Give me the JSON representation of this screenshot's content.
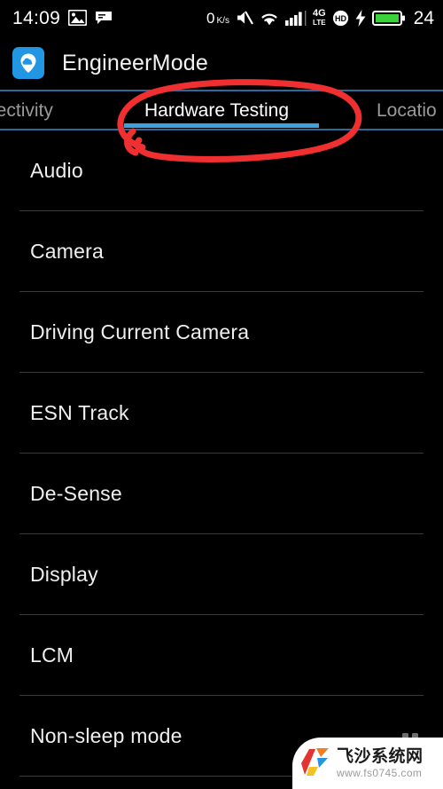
{
  "status_bar": {
    "clock": "14:09",
    "left_icons": [
      "image-icon",
      "message-icon"
    ],
    "net_speed_value": "0",
    "net_speed_unit_top": "K",
    "net_speed_unit_slash": "/",
    "net_speed_unit_bottom": "s",
    "right_icons": [
      "mute-icon",
      "wifi-icon",
      "signal-bars-icon",
      "4g-lte-icon",
      "hd-icon",
      "charging-bolt-icon",
      "battery-icon"
    ],
    "network_type_top": "4G",
    "network_type_bottom": "LTE",
    "hd_label": "HD",
    "battery_level": "24",
    "battery_color": "#3bd13b"
  },
  "app_bar": {
    "icon_name": "engineermode-app-icon",
    "icon_bg": "#2196e3",
    "title": "EngineerMode"
  },
  "tabs": {
    "accent_color": "#3da2dd",
    "rule_color": "#2b6a9c",
    "items": [
      {
        "label": "nectivity",
        "full_label": "Connectivity",
        "active": false
      },
      {
        "label": "Hardware Testing",
        "full_label": "Hardware Testing",
        "active": true
      },
      {
        "label": "Locatio",
        "full_label": "Location",
        "active": false
      }
    ]
  },
  "list": {
    "items": [
      {
        "label": "Audio"
      },
      {
        "label": "Camera"
      },
      {
        "label": "Driving Current Camera"
      },
      {
        "label": "ESN Track"
      },
      {
        "label": "De-Sense"
      },
      {
        "label": "Display"
      },
      {
        "label": "LCM"
      },
      {
        "label": "Non-sleep mode"
      }
    ]
  },
  "annotation": {
    "shape": "hand-drawn-red-ellipse",
    "color": "#f03030",
    "target": "Hardware Testing"
  },
  "watermark": {
    "logo_name": "feisha-logo-icon",
    "site_name": "飞沙系统网",
    "url": "www.fs0745.com",
    "colors": [
      "#e3342f",
      "#f08020",
      "#2196e3",
      "#f5c021"
    ]
  }
}
